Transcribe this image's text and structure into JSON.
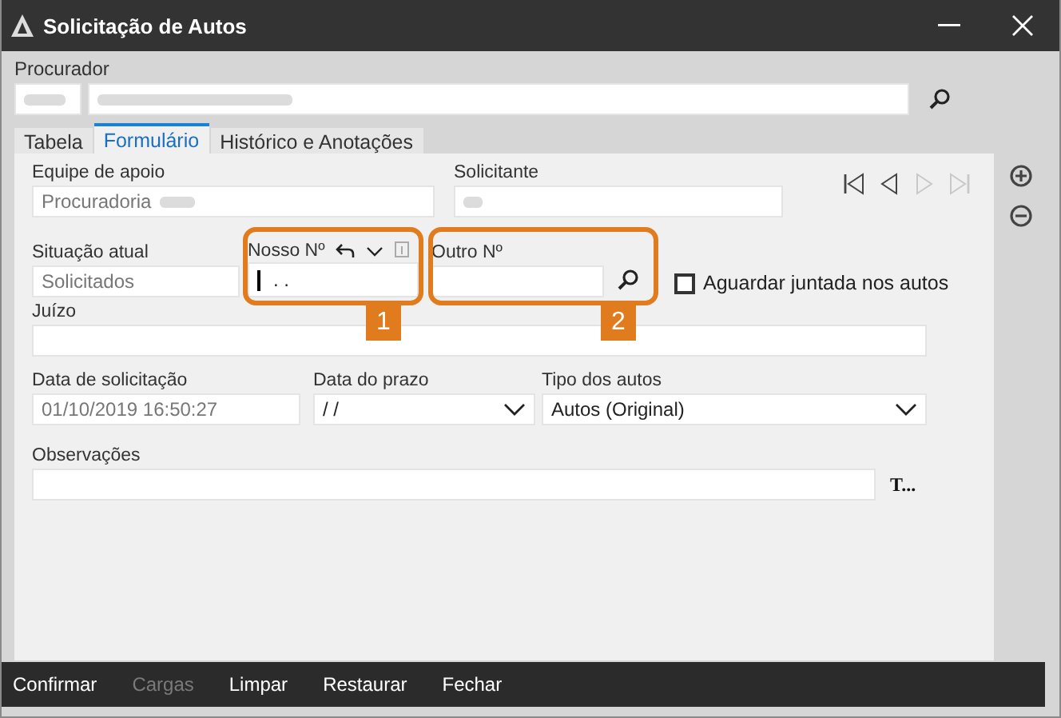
{
  "window": {
    "title": "Solicitação de Autos"
  },
  "procurador": {
    "label": "Procurador"
  },
  "tabs": [
    {
      "label": "Tabela",
      "selected": false
    },
    {
      "label": "Formulário",
      "selected": true
    },
    {
      "label": "Histórico e Anotações",
      "selected": false
    }
  ],
  "form": {
    "equipe": {
      "label": "Equipe de apoio",
      "value": "Procuradoria"
    },
    "solicitante": {
      "label": "Solicitante"
    },
    "navigation": [
      {
        "kind": "first",
        "disabled": false
      },
      {
        "kind": "previous",
        "disabled": false
      },
      {
        "kind": "next",
        "disabled": true
      },
      {
        "kind": "last",
        "disabled": true
      }
    ],
    "situacao": {
      "label": "Situação atual",
      "value": "Solicitados"
    },
    "nosso": {
      "label": "Nosso Nº",
      "value": ". ."
    },
    "outro": {
      "label": "Outro Nº"
    },
    "aguardar": {
      "label": "Aguardar juntada nos autos",
      "checked": false
    },
    "juizo": {
      "label": "Juízo"
    },
    "data_solicitacao": {
      "label": "Data de solicitação",
      "value": "01/10/2019 16:50:27"
    },
    "data_prazo": {
      "label": "Data do prazo",
      "value": "/ /"
    },
    "tipo": {
      "label": "Tipo dos autos",
      "value": "Autos (Original)"
    },
    "observacoes": {
      "label": "Observações",
      "button": "T..."
    }
  },
  "callouts": [
    {
      "number": "1"
    },
    {
      "number": "2"
    }
  ],
  "footer": [
    {
      "label": "Confirmar",
      "disabled": false
    },
    {
      "label": "Cargas",
      "disabled": true
    },
    {
      "label": "Limpar",
      "disabled": false
    },
    {
      "label": "Restaurar",
      "disabled": false
    },
    {
      "label": "Fechar",
      "disabled": false
    }
  ]
}
